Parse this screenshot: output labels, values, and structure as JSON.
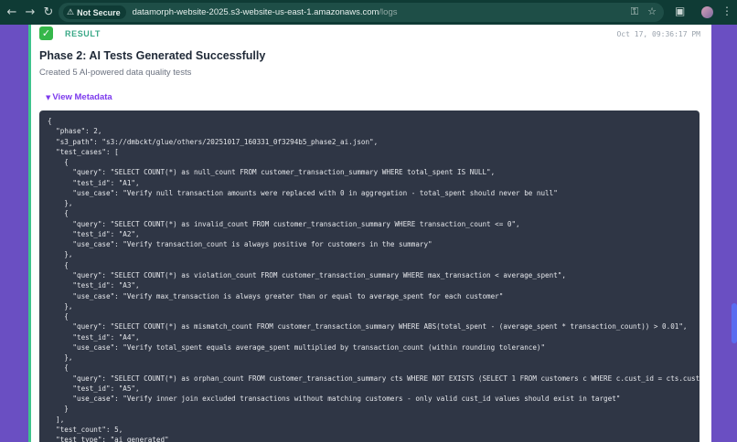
{
  "browser": {
    "security_label": "Not Secure",
    "url_host": "datamorph-website-2025.s3-website-us-east-1.amazonaws.com",
    "url_path": "/logs"
  },
  "log_entry": {
    "status_label": "RESULT",
    "timestamp": "Oct 17, 09:36:17 PM",
    "title": "Phase 2: AI Tests Generated Successfully",
    "subtitle": "Created 5 AI-powered data quality tests",
    "metadata_toggle": "View Metadata",
    "code_lines": [
      "{",
      "  \"phase\": 2,",
      "  \"s3_path\": \"s3://dmbckt/glue/others/20251017_160331_0f3294b5_phase2_ai.json\",",
      "  \"test_cases\": [",
      "    {",
      "      \"query\": \"SELECT COUNT(*) as null_count FROM customer_transaction_summary WHERE total_spent IS NULL\",",
      "      \"test_id\": \"A1\",",
      "      \"use_case\": \"Verify null transaction amounts were replaced with 0 in aggregation - total_spent should never be null\"",
      "    },",
      "    {",
      "      \"query\": \"SELECT COUNT(*) as invalid_count FROM customer_transaction_summary WHERE transaction_count <= 0\",",
      "      \"test_id\": \"A2\",",
      "      \"use_case\": \"Verify transaction_count is always positive for customers in the summary\"",
      "    },",
      "    {",
      "      \"query\": \"SELECT COUNT(*) as violation_count FROM customer_transaction_summary WHERE max_transaction < average_spent\",",
      "      \"test_id\": \"A3\",",
      "      \"use_case\": \"Verify max_transaction is always greater than or equal to average_spent for each customer\"",
      "    },",
      "    {",
      "      \"query\": \"SELECT COUNT(*) as mismatch_count FROM customer_transaction_summary WHERE ABS(total_spent - (average_spent * transaction_count)) > 0.01\",",
      "      \"test_id\": \"A4\",",
      "      \"use_case\": \"Verify total_spent equals average_spent multiplied by transaction_count (within rounding tolerance)\"",
      "    },",
      "    {",
      "      \"query\": \"SELECT COUNT(*) as orphan_count FROM customer_transaction_summary cts WHERE NOT EXISTS (SELECT 1 FROM customers c WHERE c.cust_id = cts.cust_id",
      "      \"test_id\": \"A5\",",
      "      \"use_case\": \"Verify inner join excluded transactions without matching customers - only valid cust_id values should exist in target\"",
      "    }",
      "  ],",
      "  \"test_count\": 5,",
      "  \"test_type\": \"ai_generated\""
    ]
  }
}
